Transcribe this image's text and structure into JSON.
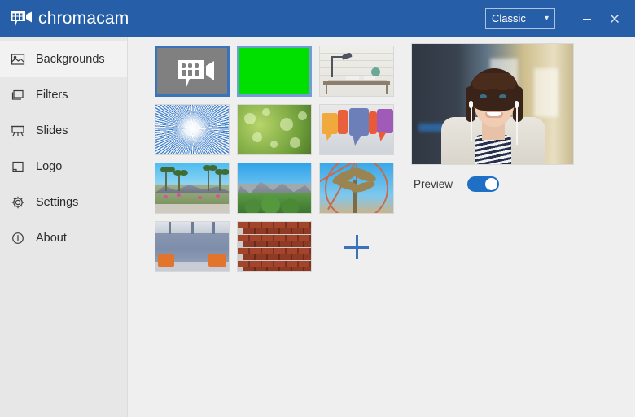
{
  "window": {
    "brand": "chromacam",
    "brand_icon": "chromacam-logo-icon",
    "accent": "#265fa8",
    "mode_select": {
      "value": "Classic",
      "chevron": "chevron-down-icon"
    },
    "minimize_label": "Minimize",
    "close_label": "Close"
  },
  "sidebar": {
    "items": [
      {
        "label": "Backgrounds",
        "icon": "image-icon",
        "selected": true
      },
      {
        "label": "Filters",
        "icon": "layers-icon",
        "selected": false
      },
      {
        "label": "Slides",
        "icon": "projector-screen-icon",
        "selected": false
      },
      {
        "label": "Logo",
        "icon": "square-icon",
        "selected": false
      },
      {
        "label": "Settings",
        "icon": "gear-icon",
        "selected": false
      },
      {
        "label": "About",
        "icon": "info-circle-icon",
        "selected": false
      }
    ]
  },
  "main": {
    "backgrounds": [
      {
        "name": "none-chromacam-logo",
        "art": "art-gray",
        "state": "selected"
      },
      {
        "name": "green-screen",
        "art": "art-green",
        "state": "active"
      },
      {
        "name": "white-brick-desk",
        "art": "art-desk",
        "state": "normal"
      },
      {
        "name": "sunburst-rays",
        "art": "art-burst",
        "state": "normal"
      },
      {
        "name": "green-bokeh",
        "art": "art-bokeh",
        "state": "normal"
      },
      {
        "name": "colorful-speech-bubbles",
        "art": "art-bubbles",
        "state": "normal"
      },
      {
        "name": "palm-garden",
        "art": "art-garden",
        "state": "normal"
      },
      {
        "name": "mountain-palms",
        "art": "art-mtn",
        "state": "normal"
      },
      {
        "name": "palm-ferris-wheel",
        "art": "art-palmwheel",
        "state": "normal"
      },
      {
        "name": "lounge-orange-chairs",
        "art": "art-lounge",
        "state": "normal"
      },
      {
        "name": "red-brick-wall",
        "art": "art-brick",
        "state": "normal"
      }
    ],
    "add_button": {
      "icon": "plus-icon",
      "label": "+"
    },
    "preview": {
      "label": "Preview",
      "toggle_on": true,
      "toggle_color": "#1f6fc4",
      "image_alt": "woman-with-earphones-office"
    }
  }
}
